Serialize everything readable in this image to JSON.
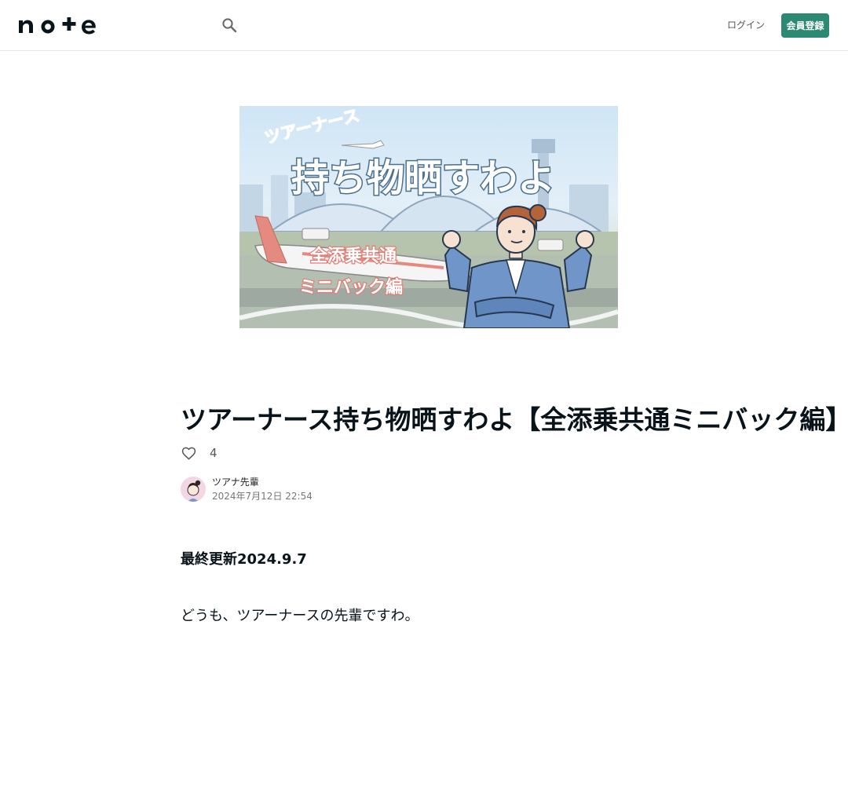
{
  "header": {
    "logo_text": "note",
    "login_label": "ログイン",
    "signup_label": "会員登録",
    "icons": {
      "search": "search-icon"
    }
  },
  "hero": {
    "top_text": "ツアーナース",
    "main_text": "持ち物晒すわよ",
    "sub_line1": "全添乗共通",
    "sub_line2": "ミニバック編"
  },
  "article": {
    "title": "ツアーナース持ち物晒すわよ【全添乗共通ミニバック編】",
    "like_count": "4",
    "author_name": "ツアナ先輩",
    "post_date": "2024年7月12日 22:54",
    "body_heading": "最終更新2024.9.7",
    "body_paragraph": "どうも、ツアーナースの先輩ですわ。"
  },
  "colors": {
    "accent": "#2c8a73",
    "text": "#08131a",
    "border": "#e6e6e6"
  }
}
